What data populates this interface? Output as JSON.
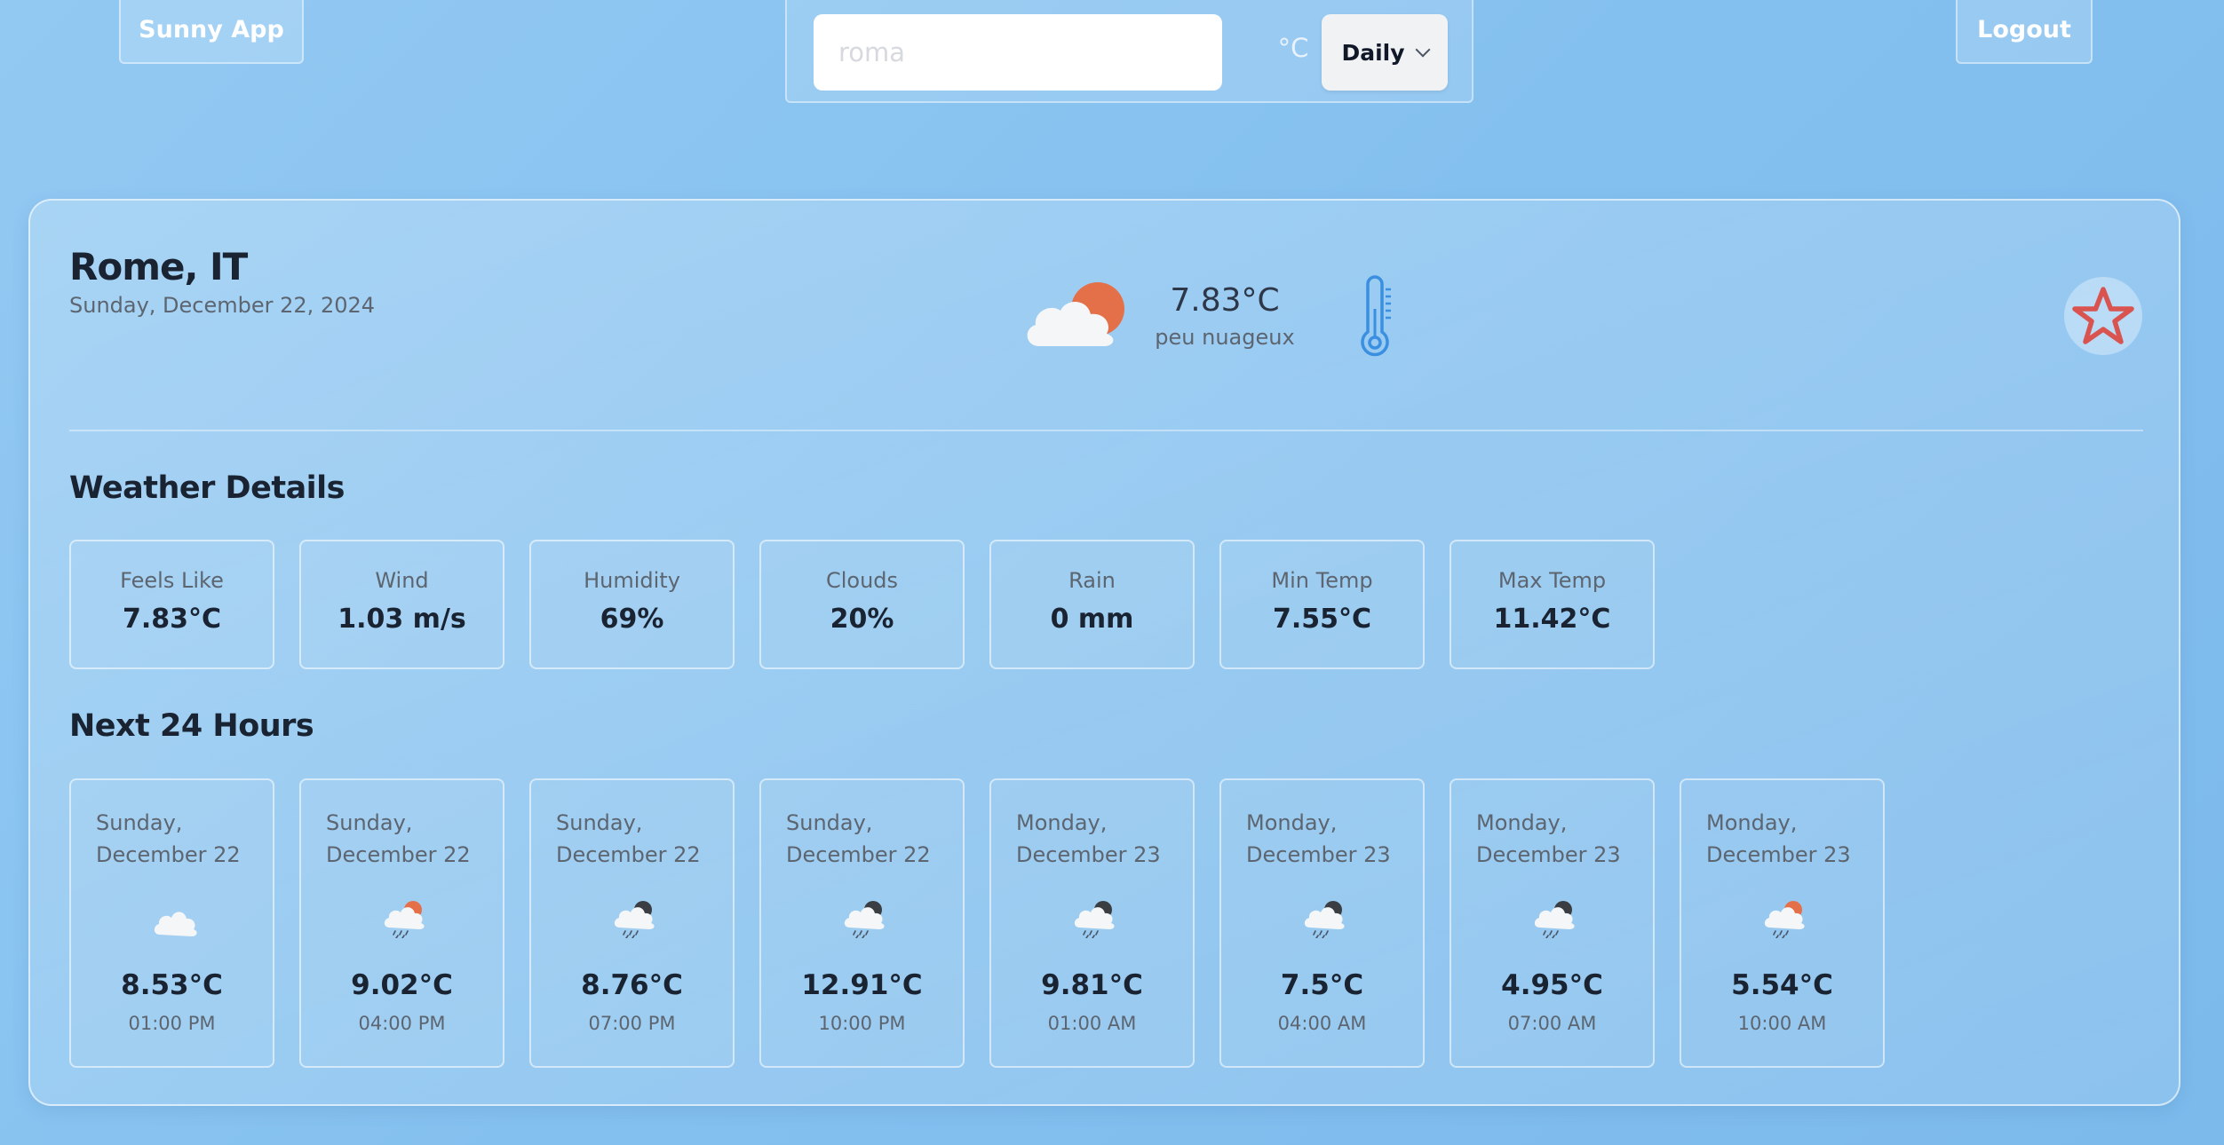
{
  "header": {
    "brand_label": "Sunny App",
    "logout_label": "Logout",
    "search_placeholder": "roma",
    "unit_label": "°C",
    "mode_label": "Daily"
  },
  "current": {
    "city": "Rome, IT",
    "date": "Sunday, December 22, 2024",
    "temp": "7.83°C",
    "description": "peu nuageux",
    "icon": "partly-cloudy-day-icon"
  },
  "details": {
    "title": "Weather Details",
    "items": [
      {
        "label": "Feels Like",
        "value": "7.83°C"
      },
      {
        "label": "Wind",
        "value": "1.03 m/s"
      },
      {
        "label": "Humidity",
        "value": "69%"
      },
      {
        "label": "Clouds",
        "value": "20%"
      },
      {
        "label": "Rain",
        "value": "0 mm"
      },
      {
        "label": "Min Temp",
        "value": "7.55°C"
      },
      {
        "label": "Max Temp",
        "value": "11.42°C"
      }
    ]
  },
  "hourly": {
    "title": "Next 24 Hours",
    "items": [
      {
        "day": "Sunday,",
        "date": "December 22",
        "temp": "8.53°C",
        "time": "01:00 PM",
        "icon": "cloud-icon"
      },
      {
        "day": "Sunday,",
        "date": "December 22",
        "temp": "9.02°C",
        "time": "04:00 PM",
        "icon": "rain-sun-icon"
      },
      {
        "day": "Sunday,",
        "date": "December 22",
        "temp": "8.76°C",
        "time": "07:00 PM",
        "icon": "rain-night-icon"
      },
      {
        "day": "Sunday,",
        "date": "December 22",
        "temp": "12.91°C",
        "time": "10:00 PM",
        "icon": "rain-night-icon"
      },
      {
        "day": "Monday,",
        "date": "December 23",
        "temp": "9.81°C",
        "time": "01:00 AM",
        "icon": "rain-night-icon"
      },
      {
        "day": "Monday,",
        "date": "December 23",
        "temp": "7.5°C",
        "time": "04:00 AM",
        "icon": "rain-night-icon"
      },
      {
        "day": "Monday,",
        "date": "December 23",
        "temp": "4.95°C",
        "time": "07:00 AM",
        "icon": "rain-night-icon"
      },
      {
        "day": "Monday,",
        "date": "December 23",
        "temp": "5.54°C",
        "time": "10:00 AM",
        "icon": "rain-sun-icon"
      }
    ]
  },
  "colors": {
    "sun": "#e4704a",
    "moon": "#3a3d42",
    "cloud": "#f4f6f8",
    "thermometer": "#3b8fe0",
    "star": "#d9534f"
  }
}
